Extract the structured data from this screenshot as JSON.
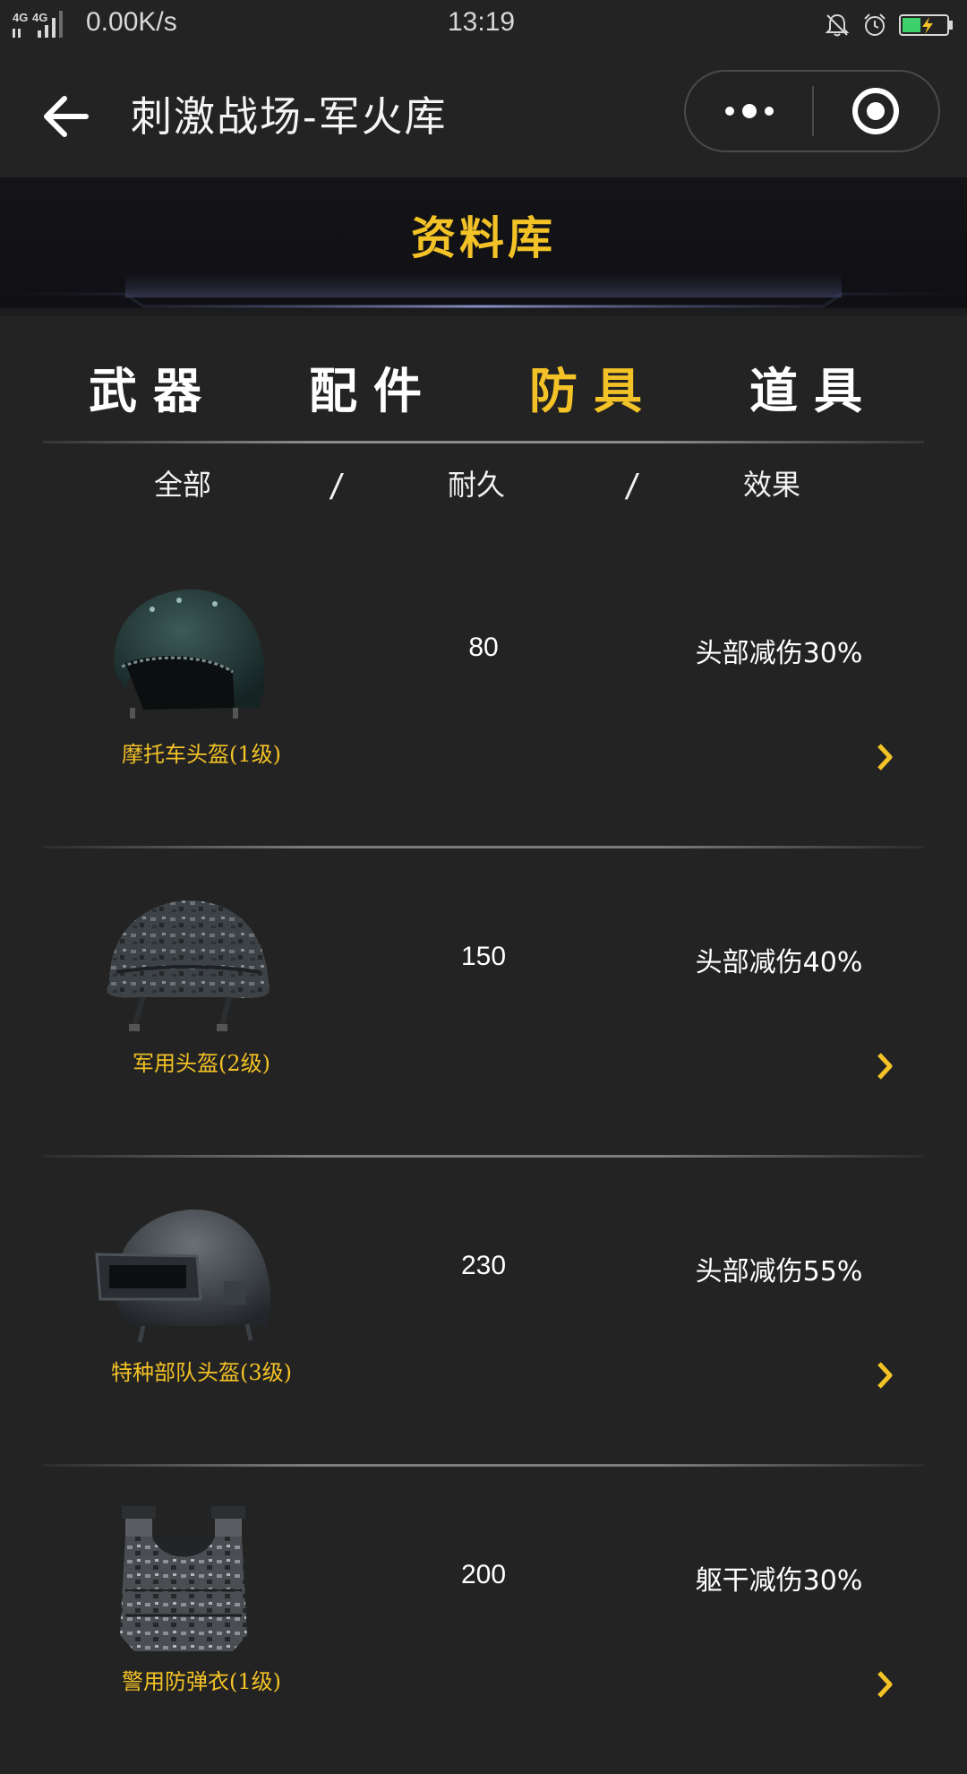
{
  "status_bar": {
    "network": "4G 4G",
    "speed": "0.00K/s",
    "time": "13:19",
    "icons": [
      "bell-off-icon",
      "alarm-icon",
      "battery-charging-icon"
    ],
    "battery_color": "#3cd16a"
  },
  "nav": {
    "title": "刺激战场-军火库",
    "back_icon": "arrow-left-icon",
    "more_icon": "more-dots-icon",
    "close_icon": "target-close-icon"
  },
  "banner": {
    "title": "资料库"
  },
  "tabs": [
    {
      "label": "武器",
      "active": false
    },
    {
      "label": "配件",
      "active": false
    },
    {
      "label": "防具",
      "active": true
    },
    {
      "label": "道具",
      "active": false
    }
  ],
  "columns": {
    "all": "全部",
    "durability": "耐久",
    "effect": "效果",
    "separator": "/"
  },
  "items": [
    {
      "name": "摩托车头盔(1级)",
      "durability": "80",
      "effect": "头部减伤30%",
      "icon": "motorcycle-helmet-icon"
    },
    {
      "name": "军用头盔(2级)",
      "durability": "150",
      "effect": "头部减伤40%",
      "icon": "military-helmet-icon"
    },
    {
      "name": "特种部队头盔(3级)",
      "durability": "230",
      "effect": "头部减伤55%",
      "icon": "spetsnaz-helmet-icon"
    },
    {
      "name": "警用防弹衣(1级)",
      "durability": "200",
      "effect": "躯干减伤30%",
      "icon": "police-vest-icon"
    }
  ],
  "colors": {
    "accent": "#f3c226",
    "background": "#232323",
    "banner": "#121216"
  }
}
